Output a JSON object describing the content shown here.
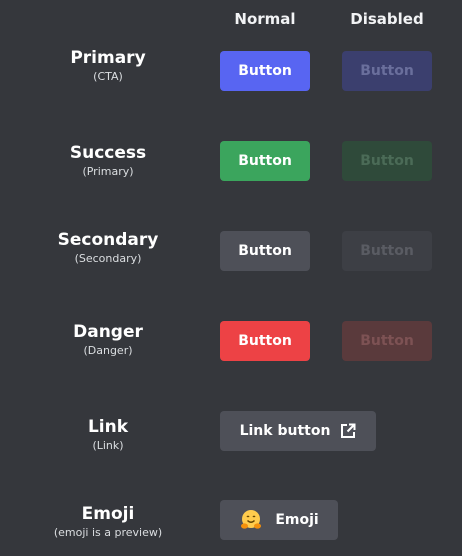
{
  "headers": {
    "normal": "Normal",
    "disabled": "Disabled"
  },
  "rows": {
    "primary": {
      "title": "Primary",
      "subtitle": "(CTA)",
      "normal_label": "Button",
      "disabled_label": "Button"
    },
    "success": {
      "title": "Success",
      "subtitle": "(Primary)",
      "normal_label": "Button",
      "disabled_label": "Button"
    },
    "secondary": {
      "title": "Secondary",
      "subtitle": "(Secondary)",
      "normal_label": "Button",
      "disabled_label": "Button"
    },
    "danger": {
      "title": "Danger",
      "subtitle": "(Danger)",
      "normal_label": "Button",
      "disabled_label": "Button"
    },
    "link": {
      "title": "Link",
      "subtitle": "(Link)",
      "label": "Link button",
      "icon": "external-link-icon"
    },
    "emoji": {
      "title": "Emoji",
      "subtitle": "(emoji is a preview)",
      "label": "Emoji",
      "icon": "hugging-face-emoji-icon"
    }
  },
  "colors": {
    "background": "#35373c",
    "primary": "#5865f2",
    "success": "#3ba55d",
    "secondary": "#4e5058",
    "danger": "#ed4245"
  }
}
